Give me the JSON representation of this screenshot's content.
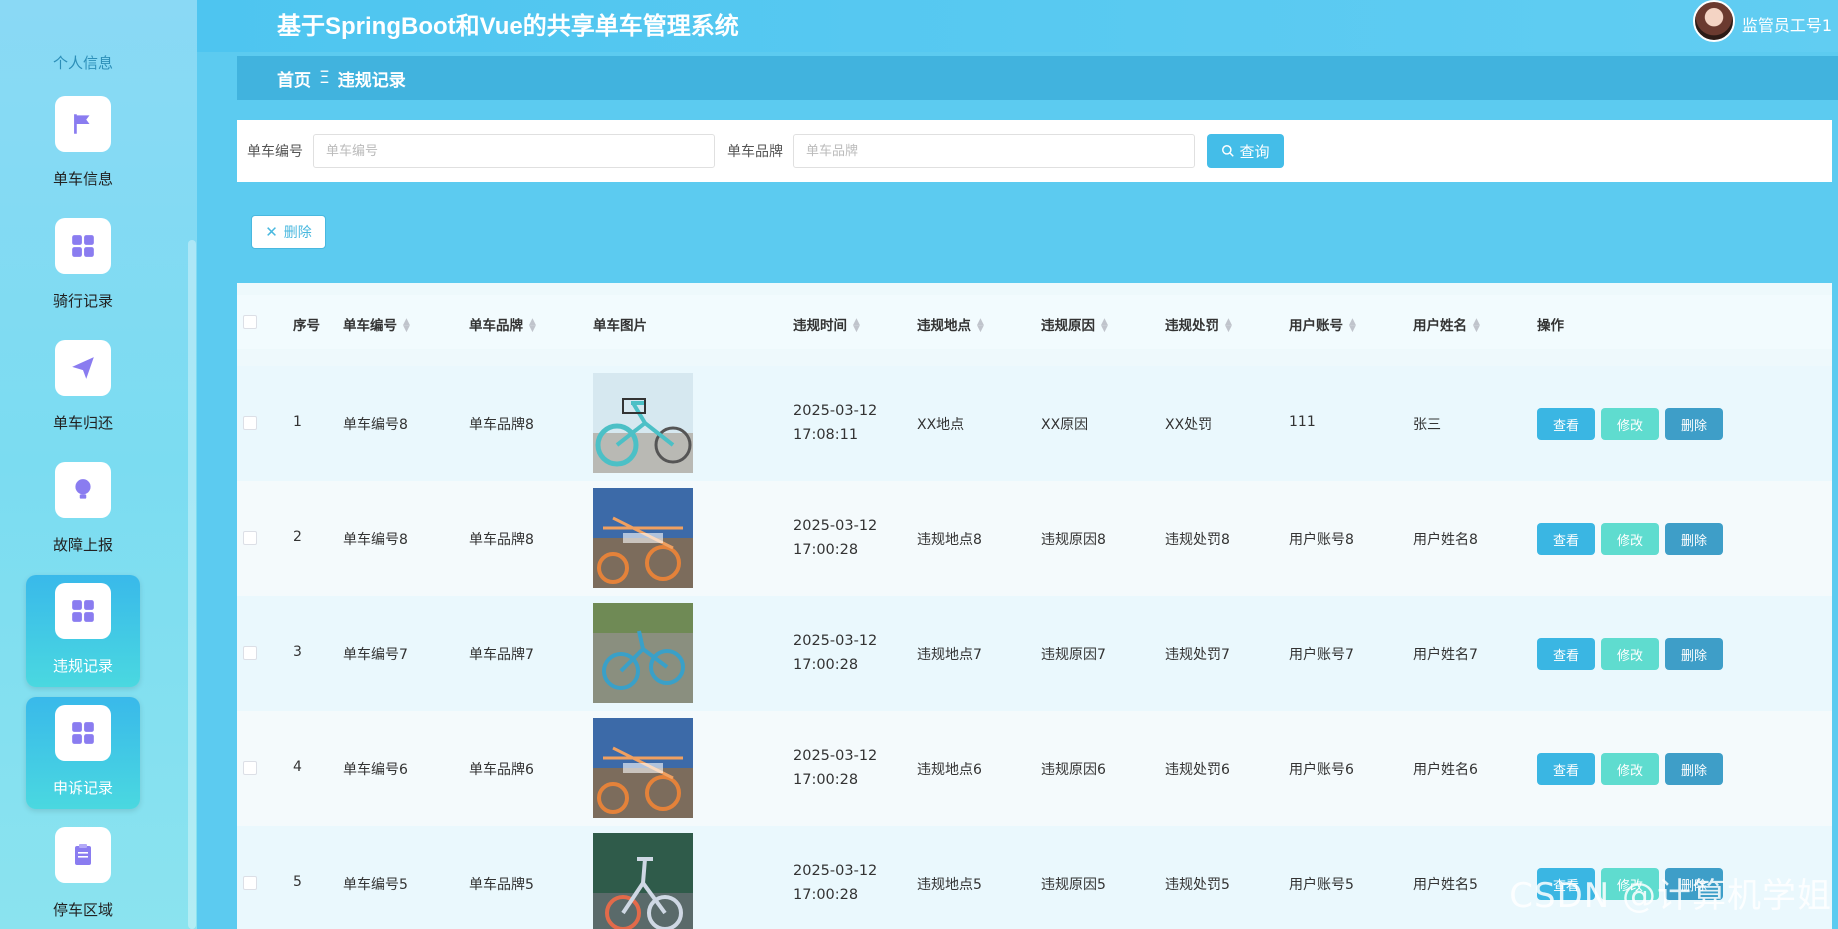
{
  "header": {
    "title": "基于SpringBoot和Vue的共享单车管理系统",
    "user_name": "监管员工号1"
  },
  "sidebar": {
    "top_label": "个人信息",
    "items": [
      {
        "label": "单车信息",
        "icon": "flag-icon"
      },
      {
        "label": "骑行记录",
        "icon": "grid-icon"
      },
      {
        "label": "单车归还",
        "icon": "paper-plane-icon"
      },
      {
        "label": "故障上报",
        "icon": "lightbulb-icon"
      },
      {
        "label": "违规记录",
        "icon": "grid-icon",
        "active": true
      },
      {
        "label": "申诉记录",
        "icon": "grid-icon",
        "active": true
      },
      {
        "label": "停车区域",
        "icon": "clipboard-icon"
      }
    ]
  },
  "breadcrumb": {
    "home": "首页",
    "separator": "Ξ",
    "current": "违规记录"
  },
  "search": {
    "field1_label": "单车编号",
    "field1_placeholder": "单车编号",
    "field2_label": "单车品牌",
    "field2_placeholder": "单车品牌",
    "query_label": "查询"
  },
  "toolbar": {
    "delete_label": "删除"
  },
  "table": {
    "headers": {
      "index": "序号",
      "bike_no": "单车编号",
      "brand": "单车品牌",
      "image": "单车图片",
      "time": "违规时间",
      "location": "违规地点",
      "reason": "违规原因",
      "penalty": "违规处罚",
      "account": "用户账号",
      "name": "用户姓名",
      "actions": "操作"
    },
    "actions": {
      "view": "查看",
      "edit": "修改",
      "delete": "删除"
    },
    "rows": [
      {
        "index": "1",
        "bike_no": "单车编号8",
        "brand": "单车品牌8",
        "time": "2025-03-12 17:08:11",
        "location": "XX地点",
        "reason": "XX原因",
        "penalty": "XX处罚",
        "account": "111",
        "name": "张三"
      },
      {
        "index": "2",
        "bike_no": "单车编号8",
        "brand": "单车品牌8",
        "time": "2025-03-12 17:00:28",
        "location": "违规地点8",
        "reason": "违规原因8",
        "penalty": "违规处罚8",
        "account": "用户账号8",
        "name": "用户姓名8"
      },
      {
        "index": "3",
        "bike_no": "单车编号7",
        "brand": "单车品牌7",
        "time": "2025-03-12 17:00:28",
        "location": "违规地点7",
        "reason": "违规原因7",
        "penalty": "违规处罚7",
        "account": "用户账号7",
        "name": "用户姓名7"
      },
      {
        "index": "4",
        "bike_no": "单车编号6",
        "brand": "单车品牌6",
        "time": "2025-03-12 17:00:28",
        "location": "违规地点6",
        "reason": "违规原因6",
        "penalty": "违规处罚6",
        "account": "用户账号6",
        "name": "用户姓名6"
      },
      {
        "index": "5",
        "bike_no": "单车编号5",
        "brand": "单车品牌5",
        "time": "2025-03-12 17:00:28",
        "location": "违规地点5",
        "reason": "违规原因5",
        "penalty": "违规处罚5",
        "account": "用户账号5",
        "name": "用户姓名5"
      }
    ]
  },
  "watermark": "CSDN @计算机学姐"
}
